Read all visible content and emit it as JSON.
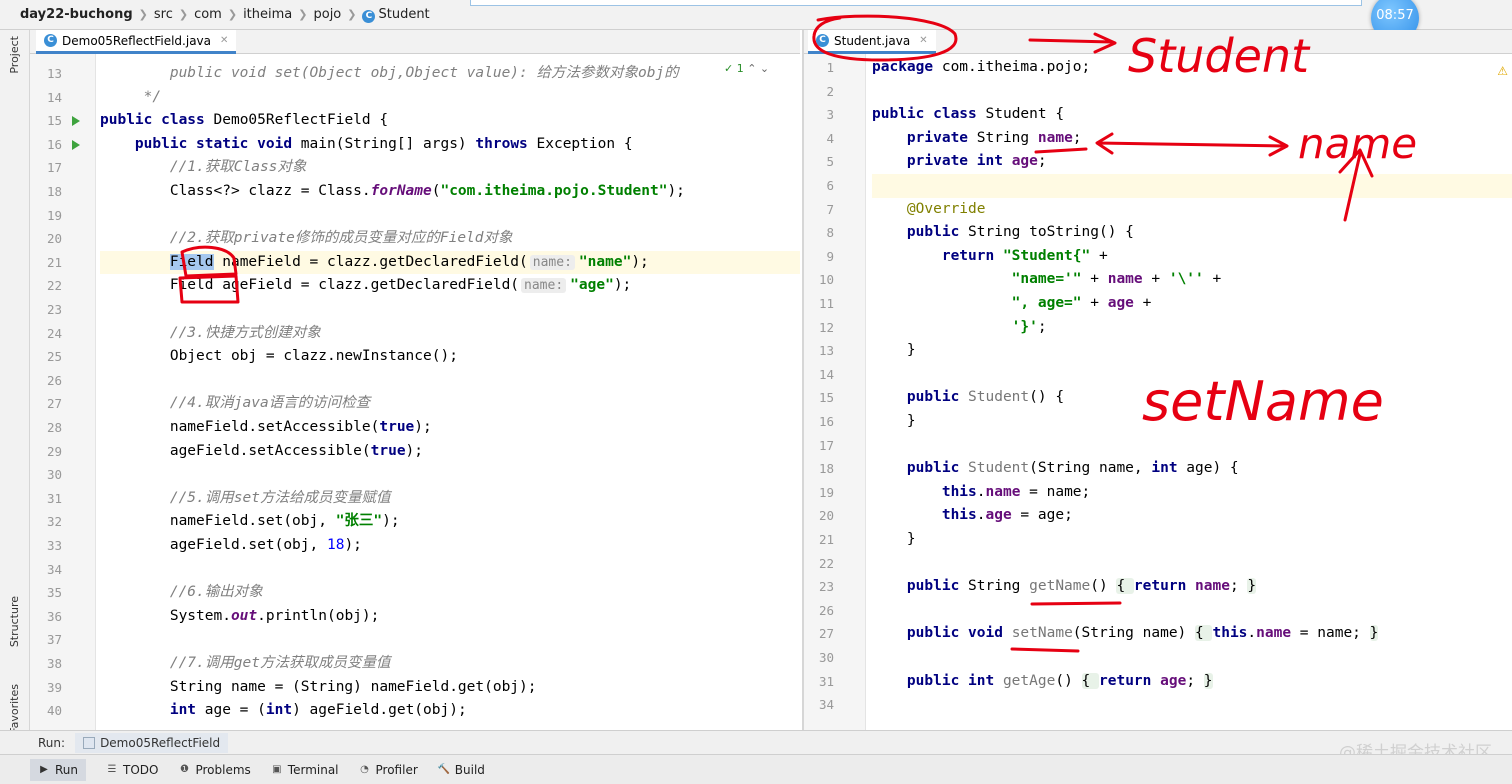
{
  "breadcrumb": [
    "day22-buchong",
    "src",
    "com",
    "itheima",
    "pojo",
    "Student"
  ],
  "clock": "08:57",
  "side_tools": {
    "project": "Project",
    "structure": "Structure",
    "favorites": "Favorites"
  },
  "left_editor": {
    "tab": "Demo05ReflectField.java",
    "inspection": "1",
    "lines": [
      {
        "n": "13",
        "segments": [
          {
            "c": "cm",
            "t": "        public void set(Object obj,Object value): 给方法参数对象obj的"
          }
        ]
      },
      {
        "n": "14",
        "segments": [
          {
            "c": "cm",
            "t": "     */"
          }
        ]
      },
      {
        "n": "15",
        "segments": [
          {
            "c": "kw",
            "t": "public class "
          },
          {
            "c": "",
            "t": "Demo05ReflectField {"
          }
        ]
      },
      {
        "n": "16",
        "segments": [
          {
            "c": "kw",
            "t": "    public static void "
          },
          {
            "c": "",
            "t": "main(String[] args) "
          },
          {
            "c": "kw",
            "t": "throws "
          },
          {
            "c": "",
            "t": "Exception {"
          }
        ]
      },
      {
        "n": "17",
        "segments": [
          {
            "c": "cm",
            "t": "        //1.获取Class对象"
          }
        ]
      },
      {
        "n": "18",
        "segments": [
          {
            "c": "",
            "t": "        Class<?> clazz = Class."
          },
          {
            "c": "st",
            "t": "forName"
          },
          {
            "c": "",
            "t": "("
          },
          {
            "c": "str",
            "t": "\"com.itheima.pojo.Student\""
          },
          {
            "c": "",
            "t": ");"
          }
        ]
      },
      {
        "n": "19",
        "segments": []
      },
      {
        "n": "20",
        "segments": [
          {
            "c": "cm",
            "t": "        //2.获取private修饰的成员变量对应的Field对象"
          }
        ]
      },
      {
        "n": "21",
        "segments": [
          {
            "c": "",
            "t": "        "
          },
          {
            "c": "sel",
            "t": "Field"
          },
          {
            "c": "",
            "t": " nameField = clazz.getDeclaredField("
          },
          {
            "c": "hint",
            "t": "name:"
          },
          {
            "c": "str",
            "t": "\"name\""
          },
          {
            "c": "",
            "t": ");"
          }
        ]
      },
      {
        "n": "22",
        "segments": [
          {
            "c": "",
            "t": "        Field ageField = clazz.getDeclaredField("
          },
          {
            "c": "hint",
            "t": "name:"
          },
          {
            "c": "str",
            "t": "\"age\""
          },
          {
            "c": "",
            "t": ");"
          }
        ]
      },
      {
        "n": "23",
        "segments": []
      },
      {
        "n": "24",
        "segments": [
          {
            "c": "cm",
            "t": "        //3.快捷方式创建对象"
          }
        ]
      },
      {
        "n": "25",
        "segments": [
          {
            "c": "",
            "t": "        Object obj = clazz.newInstance();"
          }
        ]
      },
      {
        "n": "26",
        "segments": []
      },
      {
        "n": "27",
        "segments": [
          {
            "c": "cm",
            "t": "        //4.取消java语言的访问检查"
          }
        ]
      },
      {
        "n": "28",
        "segments": [
          {
            "c": "",
            "t": "        nameField.setAccessible("
          },
          {
            "c": "kw",
            "t": "true"
          },
          {
            "c": "",
            "t": ");"
          }
        ]
      },
      {
        "n": "29",
        "segments": [
          {
            "c": "",
            "t": "        ageField.setAccessible("
          },
          {
            "c": "kw",
            "t": "true"
          },
          {
            "c": "",
            "t": ");"
          }
        ]
      },
      {
        "n": "30",
        "segments": []
      },
      {
        "n": "31",
        "segments": [
          {
            "c": "cm",
            "t": "        //5.调用set方法给成员变量赋值"
          }
        ]
      },
      {
        "n": "32",
        "segments": [
          {
            "c": "",
            "t": "        nameField.set(obj, "
          },
          {
            "c": "str",
            "t": "\"张三\""
          },
          {
            "c": "",
            "t": ");"
          }
        ]
      },
      {
        "n": "33",
        "segments": [
          {
            "c": "",
            "t": "        ageField.set(obj, "
          },
          {
            "c": "kwn",
            "t": "18"
          },
          {
            "c": "",
            "t": ");"
          }
        ]
      },
      {
        "n": "34",
        "segments": []
      },
      {
        "n": "35",
        "segments": [
          {
            "c": "cm",
            "t": "        //6.输出对象"
          }
        ]
      },
      {
        "n": "36",
        "segments": [
          {
            "c": "",
            "t": "        System."
          },
          {
            "c": "st",
            "t": "out"
          },
          {
            "c": "",
            "t": ".println(obj);"
          }
        ]
      },
      {
        "n": "37",
        "segments": []
      },
      {
        "n": "38",
        "segments": [
          {
            "c": "cm",
            "t": "        //7.调用get方法获取成员变量值"
          }
        ]
      },
      {
        "n": "39",
        "segments": [
          {
            "c": "",
            "t": "        String name = (String) nameField.get(obj);"
          }
        ]
      },
      {
        "n": "40",
        "segments": [
          {
            "c": "kw",
            "t": "        int "
          },
          {
            "c": "",
            "t": "age = ("
          },
          {
            "c": "kw",
            "t": "int"
          },
          {
            "c": "",
            "t": ") ageField.get(obj);"
          }
        ]
      }
    ]
  },
  "right_editor": {
    "tab": "Student.java",
    "lines": [
      {
        "n": "1",
        "segments": [
          {
            "c": "kw",
            "t": "package "
          },
          {
            "c": "",
            "t": "com.itheima.pojo;"
          }
        ]
      },
      {
        "n": "2",
        "segments": []
      },
      {
        "n": "3",
        "segments": [
          {
            "c": "kw",
            "t": "public class "
          },
          {
            "c": "",
            "t": "Student {"
          }
        ]
      },
      {
        "n": "4",
        "segments": [
          {
            "c": "kw",
            "t": "    private "
          },
          {
            "c": "",
            "t": "String "
          },
          {
            "c": "fld",
            "t": "name"
          },
          {
            "c": "",
            "t": ";"
          }
        ]
      },
      {
        "n": "5",
        "segments": [
          {
            "c": "kw",
            "t": "    private int "
          },
          {
            "c": "fld",
            "t": "age"
          },
          {
            "c": "",
            "t": ";"
          }
        ]
      },
      {
        "n": "6",
        "segments": []
      },
      {
        "n": "7",
        "segments": [
          {
            "c": "ann",
            "t": "    @Override"
          }
        ]
      },
      {
        "n": "8",
        "segments": [
          {
            "c": "kw",
            "t": "    public "
          },
          {
            "c": "",
            "t": "String toString() {"
          }
        ]
      },
      {
        "n": "9",
        "segments": [
          {
            "c": "kw",
            "t": "        return "
          },
          {
            "c": "str",
            "t": "\"Student{\""
          },
          {
            "c": "",
            "t": " +"
          }
        ]
      },
      {
        "n": "10",
        "segments": [
          {
            "c": "str",
            "t": "                \"name='\""
          },
          {
            "c": "",
            "t": " + "
          },
          {
            "c": "fld",
            "t": "name"
          },
          {
            "c": "",
            "t": " + "
          },
          {
            "c": "str",
            "t": "'\\''"
          },
          {
            "c": "",
            "t": " +"
          }
        ]
      },
      {
        "n": "11",
        "segments": [
          {
            "c": "str",
            "t": "                \", age=\""
          },
          {
            "c": "",
            "t": " + "
          },
          {
            "c": "fld",
            "t": "age"
          },
          {
            "c": "",
            "t": " +"
          }
        ]
      },
      {
        "n": "12",
        "segments": [
          {
            "c": "str",
            "t": "                '}'"
          },
          {
            "c": "",
            "t": ";"
          }
        ]
      },
      {
        "n": "13",
        "segments": [
          {
            "c": "",
            "t": "    }"
          }
        ]
      },
      {
        "n": "14",
        "segments": []
      },
      {
        "n": "15",
        "segments": [
          {
            "c": "kw",
            "t": "    public "
          },
          {
            "c": "ctor",
            "t": "Student"
          },
          {
            "c": "",
            "t": "() {"
          }
        ]
      },
      {
        "n": "16",
        "segments": [
          {
            "c": "",
            "t": "    }"
          }
        ]
      },
      {
        "n": "17",
        "segments": []
      },
      {
        "n": "18",
        "segments": [
          {
            "c": "kw",
            "t": "    public "
          },
          {
            "c": "ctor",
            "t": "Student"
          },
          {
            "c": "",
            "t": "(String name, "
          },
          {
            "c": "kw",
            "t": "int "
          },
          {
            "c": "",
            "t": "age) {"
          }
        ]
      },
      {
        "n": "19",
        "segments": [
          {
            "c": "kw",
            "t": "        this"
          },
          {
            "c": "",
            "t": "."
          },
          {
            "c": "fld",
            "t": "name"
          },
          {
            "c": "",
            "t": " = name;"
          }
        ]
      },
      {
        "n": "20",
        "segments": [
          {
            "c": "kw",
            "t": "        this"
          },
          {
            "c": "",
            "t": "."
          },
          {
            "c": "fld",
            "t": "age"
          },
          {
            "c": "",
            "t": " = age;"
          }
        ]
      },
      {
        "n": "21",
        "segments": [
          {
            "c": "",
            "t": "    }"
          }
        ]
      },
      {
        "n": "22",
        "segments": []
      },
      {
        "n": "23",
        "segments": [
          {
            "c": "kw",
            "t": "    public "
          },
          {
            "c": "",
            "t": "String "
          },
          {
            "c": "ctor",
            "t": "getName"
          },
          {
            "c": "",
            "t": "() "
          },
          {
            "c": "fold",
            "t": "{ "
          },
          {
            "c": "kw",
            "t": "return "
          },
          {
            "c": "fld",
            "t": "name"
          },
          {
            "c": "",
            "t": "; "
          },
          {
            "c": "fold",
            "t": "}"
          }
        ]
      },
      {
        "n": "26",
        "segments": []
      },
      {
        "n": "27",
        "segments": [
          {
            "c": "kw",
            "t": "    public void "
          },
          {
            "c": "ctor",
            "t": "setName"
          },
          {
            "c": "",
            "t": "(String name) "
          },
          {
            "c": "fold",
            "t": "{ "
          },
          {
            "c": "kw",
            "t": "this"
          },
          {
            "c": "",
            "t": "."
          },
          {
            "c": "fld",
            "t": "name"
          },
          {
            "c": "",
            "t": " = name; "
          },
          {
            "c": "fold",
            "t": "}"
          }
        ]
      },
      {
        "n": "30",
        "segments": []
      },
      {
        "n": "31",
        "segments": [
          {
            "c": "kw",
            "t": "    public int "
          },
          {
            "c": "ctor",
            "t": "getAge"
          },
          {
            "c": "",
            "t": "() "
          },
          {
            "c": "fold",
            "t": "{ "
          },
          {
            "c": "kw",
            "t": "return "
          },
          {
            "c": "fld",
            "t": "age"
          },
          {
            "c": "",
            "t": "; "
          },
          {
            "c": "fold",
            "t": "}"
          }
        ]
      },
      {
        "n": "34",
        "segments": []
      }
    ]
  },
  "run_bar": {
    "label": "Run:",
    "tab": "Demo05ReflectField"
  },
  "bottom_tools": [
    "Run",
    "TODO",
    "Problems",
    "Terminal",
    "Profiler",
    "Build"
  ],
  "watermark": "@稀土掘金技术社区",
  "annotations": {
    "student": "Student",
    "name": "name",
    "setname": "setName"
  }
}
